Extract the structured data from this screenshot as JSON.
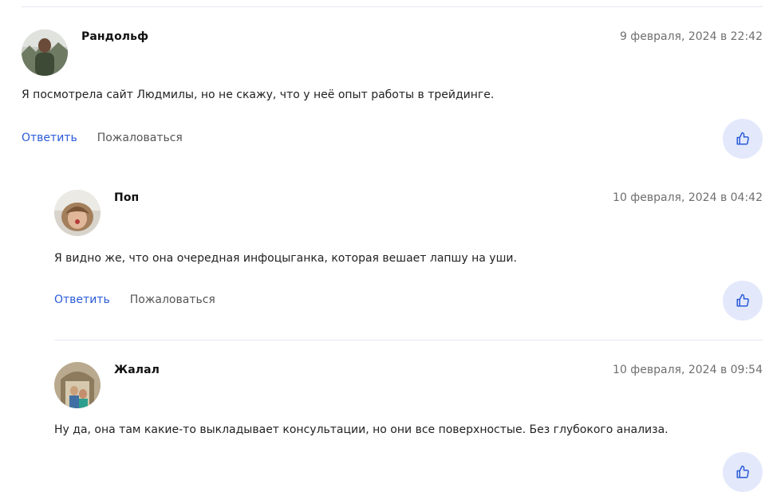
{
  "comments": [
    {
      "author": "Рандольф",
      "date": "9 февраля, 2024 в 22:42",
      "text": "Я посмотрела сайт Людмилы, но не скажу, что у неё опыт работы в трейдинге.",
      "reply_label": "Ответить",
      "report_label": "Пожаловаться",
      "like_icon": "thumbs-up-icon"
    },
    {
      "author": "Поп",
      "date": "10 февраля, 2024 в 04:42",
      "text": "Я видно же, что она очередная инфоцыганка, которая вешает лапшу на уши.",
      "reply_label": "Ответить",
      "report_label": "Пожаловаться",
      "like_icon": "thumbs-up-icon"
    },
    {
      "author": "Жалал",
      "date": "10 февраля, 2024 в 09:54",
      "text": "Ну да, она там какие-то выкладывает консультации, но они все поверхностые. Без глубокого анализа.",
      "like_icon": "thumbs-up-icon"
    }
  ],
  "colors": {
    "link": "#2a5bd7",
    "like_bg": "#e3e8fb",
    "divider": "#e6e8f2"
  }
}
